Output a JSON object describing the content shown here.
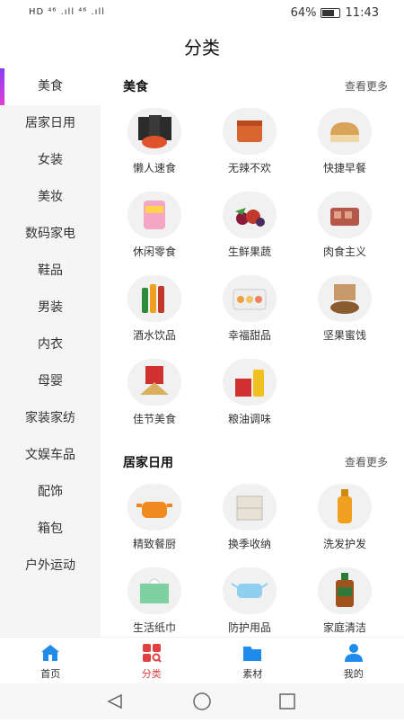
{
  "status_bar": {
    "left": "HD ⁴⁶ .ıll ⁴⁶ .ıll",
    "battery": "64%",
    "time": "11:43"
  },
  "header": {
    "title": "分类"
  },
  "sidebar": {
    "items": [
      {
        "label": "美食"
      },
      {
        "label": "居家日用"
      },
      {
        "label": "女装"
      },
      {
        "label": "美妆"
      },
      {
        "label": "数码家电"
      },
      {
        "label": "鞋品"
      },
      {
        "label": "男装"
      },
      {
        "label": "内衣"
      },
      {
        "label": "母婴"
      },
      {
        "label": "家装家纺"
      },
      {
        "label": "文娱车品"
      },
      {
        "label": "配饰"
      },
      {
        "label": "箱包"
      },
      {
        "label": "户外运动"
      }
    ]
  },
  "sections": [
    {
      "title": "美食",
      "more": "查看更多",
      "items": [
        {
          "label": "懒人速食",
          "icon": "instant-food-icon"
        },
        {
          "label": "无辣不欢",
          "icon": "spicy-meat-icon"
        },
        {
          "label": "快捷早餐",
          "icon": "bread-icon"
        },
        {
          "label": "休闲零食",
          "icon": "snack-bag-icon"
        },
        {
          "label": "生鲜果蔬",
          "icon": "fruit-icon"
        },
        {
          "label": "肉食主义",
          "icon": "meat-box-icon"
        },
        {
          "label": "酒水饮品",
          "icon": "bottles-icon"
        },
        {
          "label": "幸福甜品",
          "icon": "dessert-box-icon"
        },
        {
          "label": "坚果蜜饯",
          "icon": "nuts-icon"
        },
        {
          "label": "佳节美食",
          "icon": "zongzi-icon"
        },
        {
          "label": "粮油调味",
          "icon": "oil-bottle-icon"
        }
      ]
    },
    {
      "title": "居家日用",
      "more": "查看更多",
      "items": [
        {
          "label": "精致餐厨",
          "icon": "pot-icon"
        },
        {
          "label": "换季收纳",
          "icon": "storage-drawer-icon"
        },
        {
          "label": "洗发护发",
          "icon": "shampoo-icon"
        },
        {
          "label": "生活纸巾",
          "icon": "tissue-icon"
        },
        {
          "label": "防护用品",
          "icon": "mask-icon"
        },
        {
          "label": "家庭清洁",
          "icon": "disinfectant-icon"
        }
      ]
    }
  ],
  "tabbar": {
    "items": [
      {
        "label": "首页",
        "icon": "home-icon"
      },
      {
        "label": "分类",
        "icon": "category-icon"
      },
      {
        "label": "素材",
        "icon": "folder-icon"
      },
      {
        "label": "我的",
        "icon": "user-icon"
      }
    ]
  },
  "colors": {
    "active_tab": "#e04040",
    "sidebar_accent_start": "#8b3df7",
    "sidebar_accent_end": "#e23dd6",
    "sidebar_bg": "#f5f5f5",
    "tab_icon_blue": "#1f8ceb"
  }
}
